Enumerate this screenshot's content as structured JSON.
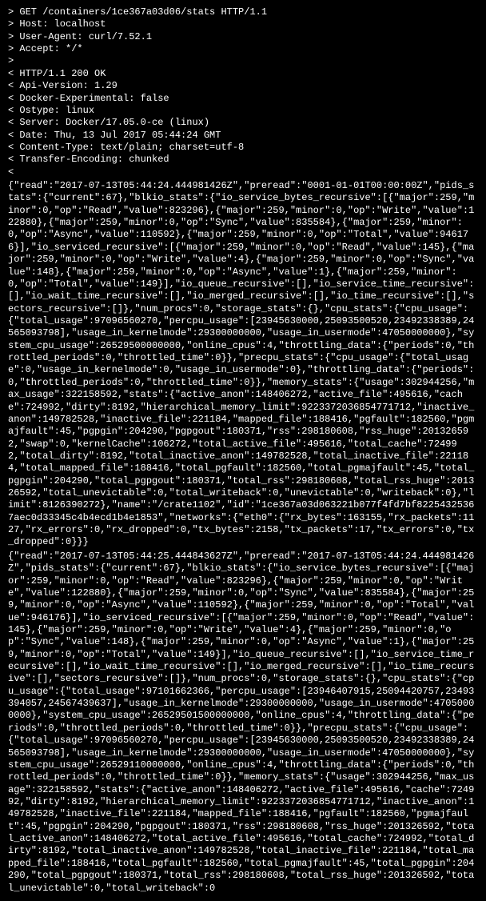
{
  "request": {
    "prompt": ">",
    "lines": [
      "GET /containers/1ce367a03d06/stats HTTP/1.1",
      "Host: localhost",
      "User-Agent: curl/7.52.1",
      "Accept: */*",
      ""
    ]
  },
  "response_headers": {
    "prompt": "<",
    "lines": [
      "HTTP/1.1 200 OK",
      "Api-Version: 1.29",
      "Docker-Experimental: false",
      "Ostype: linux",
      "Server: Docker/17.05.0-ce (linux)",
      "Date: Thu, 13 Jul 2017 05:44:24 GMT",
      "Content-Type: text/plain; charset=utf-8",
      "Transfer-Encoding: chunked",
      ""
    ]
  },
  "json_blobs": [
    "{\"read\":\"2017-07-13T05:44:24.444981426Z\",\"preread\":\"0001-01-01T00:00:00Z\",\"pids_stats\":{\"current\":67},\"blkio_stats\":{\"io_service_bytes_recursive\":[{\"major\":259,\"minor\":0,\"op\":\"Read\",\"value\":823296},{\"major\":259,\"minor\":0,\"op\":\"Write\",\"value\":122880},{\"major\":259,\"minor\":0,\"op\":\"Sync\",\"value\":835584},{\"major\":259,\"minor\":0,\"op\":\"Async\",\"value\":110592},{\"major\":259,\"minor\":0,\"op\":\"Total\",\"value\":946176}],\"io_serviced_recursive\":[{\"major\":259,\"minor\":0,\"op\":\"Read\",\"value\":145},{\"major\":259,\"minor\":0,\"op\":\"Write\",\"value\":4},{\"major\":259,\"minor\":0,\"op\":\"Sync\",\"value\":148},{\"major\":259,\"minor\":0,\"op\":\"Async\",\"value\":1},{\"major\":259,\"minor\":0,\"op\":\"Total\",\"value\":149}],\"io_queue_recursive\":[],\"io_service_time_recursive\":[],\"io_wait_time_recursive\":[],\"io_merged_recursive\":[],\"io_time_recursive\":[],\"sectors_recursive\":[]},\"num_procs\":0,\"storage_stats\":{},\"cpu_stats\":{\"cpu_usage\":{\"total_usage\":97096560270,\"percpu_usage\":[23945630000,25093500520,23492338389,24565093798],\"usage_in_kernelmode\":29300000000,\"usage_in_usermode\":47050000000},\"system_cpu_usage\":26529500000000,\"online_cpus\":4,\"throttling_data\":{\"periods\":0,\"throttled_periods\":0,\"throttled_time\":0}},\"precpu_stats\":{\"cpu_usage\":{\"total_usage\":0,\"usage_in_kernelmode\":0,\"usage_in_usermode\":0},\"throttling_data\":{\"periods\":0,\"throttled_periods\":0,\"throttled_time\":0}},\"memory_stats\":{\"usage\":302944256,\"max_usage\":322158592,\"stats\":{\"active_anon\":148406272,\"active_file\":495616,\"cache\":724992,\"dirty\":8192,\"hierarchical_memory_limit\":9223372036854771712,\"inactive_anon\":149782528,\"inactive_file\":221184,\"mapped_file\":188416,\"pgfault\":182560,\"pgmajfault\":45,\"pgpgin\":204290,\"pgpgout\":180371,\"rss\":298180608,\"rss_huge\":201326592,\"swap\":0,\"kernelCache\":106272,\"total_active_file\":495616,\"total_cache\":724992,\"total_dirty\":8192,\"total_inactive_anon\":149782528,\"total_inactive_file\":221184,\"total_mapped_file\":188416,\"total_pgfault\":182560,\"total_pgmajfault\":45,\"total_pgpgin\":204290,\"total_pgpgout\":180371,\"total_rss\":298180608,\"total_rss_huge\":201326592,\"total_unevictable\":0,\"total_writeback\":0,\"unevictable\":0,\"writeback\":0},\"limit\":8126390272},\"name\":\"/crate1102\",\"id\":\"1ce367a03d063221b077f4fd7bf82254325367aec0d33345c4b4ecd1b4e1853\",\"networks\":{\"eth0\":{\"rx_bytes\":163155,\"rx_packets\":1127,\"rx_errors\":0,\"rx_dropped\":0,\"tx_bytes\":2158,\"tx_packets\":17,\"tx_errors\":0,\"tx_dropped\":0}}}",
    "{\"read\":\"2017-07-13T05:44:25.444843627Z\",\"preread\":\"2017-07-13T05:44:24.444981426Z\",\"pids_stats\":{\"current\":67},\"blkio_stats\":{\"io_service_bytes_recursive\":[{\"major\":259,\"minor\":0,\"op\":\"Read\",\"value\":823296},{\"major\":259,\"minor\":0,\"op\":\"Write\",\"value\":122880},{\"major\":259,\"minor\":0,\"op\":\"Sync\",\"value\":835584},{\"major\":259,\"minor\":0,\"op\":\"Async\",\"value\":110592},{\"major\":259,\"minor\":0,\"op\":\"Total\",\"value\":946176}],\"io_serviced_recursive\":[{\"major\":259,\"minor\":0,\"op\":\"Read\",\"value\":145},{\"major\":259,\"minor\":0,\"op\":\"Write\",\"value\":4},{\"major\":259,\"minor\":0,\"op\":\"Sync\",\"value\":148},{\"major\":259,\"minor\":0,\"op\":\"Async\",\"value\":1},{\"major\":259,\"minor\":0,\"op\":\"Total\",\"value\":149}],\"io_queue_recursive\":[],\"io_service_time_recursive\":[],\"io_wait_time_recursive\":[],\"io_merged_recursive\":[],\"io_time_recursive\":[],\"sectors_recursive\":[]},\"num_procs\":0,\"storage_stats\":{},\"cpu_stats\":{\"cpu_usage\":{\"total_usage\":97101662366,\"percpu_usage\":[23946407915,25094420757,23493394057,24567439637],\"usage_in_kernelmode\":29300000000,\"usage_in_usermode\":47050000000},\"system_cpu_usage\":26529501500000000,\"online_cpus\":4,\"throttling_data\":{\"periods\":0,\"throttled_periods\":0,\"throttled_time\":0}},\"precpu_stats\":{\"cpu_usage\":{\"total_usage\":97096560270,\"percpu_usage\":[23945630000,25093500520,23492338389,24565093798],\"usage_in_kernelmode\":29300000000,\"usage_in_usermode\":47050000000},\"system_cpu_usage\":26529110000000,\"online_cpus\":4,\"throttling_data\":{\"periods\":0,\"throttled_periods\":0,\"throttled_time\":0}},\"memory_stats\":{\"usage\":302944256,\"max_usage\":322158592,\"stats\":{\"active_anon\":148406272,\"active_file\":495616,\"cache\":724992,\"dirty\":8192,\"hierarchical_memory_limit\":9223372036854771712,\"inactive_anon\":149782528,\"inactive_file\":221184,\"mapped_file\":188416,\"pgfault\":182560,\"pgmajfault\":45,\"pgpgin\":204290,\"pgpgout\":180371,\"rss\":298180608,\"rss_huge\":201326592,\"total_active_anon\":148406272,\"total_active_file\":495616,\"total_cache\":724992,\"total_dirty\":8192,\"total_inactive_anon\":149782528,\"total_inactive_file\":221184,\"total_mapped_file\":188416,\"total_pgfault\":182560,\"total_pgmajfault\":45,\"total_pgpgin\":204290,\"total_pgpgout\":180371,\"total_rss\":298180608,\"total_rss_huge\":201326592,\"total_unevictable\":0,\"total_writeback\":0"
  ]
}
